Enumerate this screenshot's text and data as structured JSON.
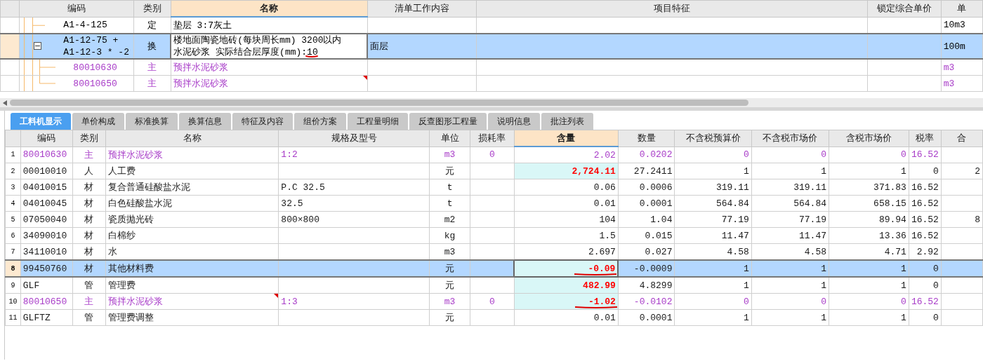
{
  "top_table": {
    "columns": [
      {
        "label": "编码",
        "selected": false
      },
      {
        "label": "类别",
        "selected": false
      },
      {
        "label": "名称",
        "selected": true
      },
      {
        "label": "清单工作内容",
        "selected": false
      },
      {
        "label": "项目特征",
        "selected": false
      },
      {
        "label": "锁定综合单价",
        "selected": false
      },
      {
        "label": "单",
        "selected": false
      }
    ],
    "rows": [
      {
        "code": "A1-4-125",
        "type": "定",
        "kind": "quota",
        "name": "垫层 3:7灰土",
        "unit": "10m3",
        "selected": false,
        "marked": false,
        "note": false
      },
      {
        "code": "A1-12-75 + A1-12-3 * -2",
        "type": "换",
        "kind": "quota",
        "name": "楼地面陶瓷地砖(每块周长mm) 3200以内水泥砂浆  实际结合层厚度(mm):10",
        "work": "面层",
        "unit": "100m",
        "selected": true,
        "marked": true,
        "note": false,
        "expanded": true,
        "children": [
          {
            "code": "80010630",
            "type": "主",
            "kind": "main",
            "name": "预拌水泥砂浆",
            "unit": "m3",
            "selected": false,
            "marked": false,
            "note": false
          },
          {
            "code": "80010650",
            "type": "主",
            "kind": "main",
            "name": "预拌水泥砂浆",
            "unit": "m3",
            "selected": false,
            "marked": false,
            "note": true
          }
        ]
      }
    ]
  },
  "tabs": [
    {
      "label": "工料机显示",
      "selected": true
    },
    {
      "label": "单价构成",
      "selected": false
    },
    {
      "label": "标准换算",
      "selected": false
    },
    {
      "label": "换算信息",
      "selected": false
    },
    {
      "label": "特征及内容",
      "selected": false
    },
    {
      "label": "组价方案",
      "selected": false
    },
    {
      "label": "工程量明细",
      "selected": false
    },
    {
      "label": "反查图形工程量",
      "selected": false
    },
    {
      "label": "说明信息",
      "selected": false
    },
    {
      "label": "批注列表",
      "selected": false
    }
  ],
  "grid": {
    "columns": [
      {
        "label": "编码",
        "selected": false
      },
      {
        "label": "类别",
        "selected": false
      },
      {
        "label": "名称",
        "selected": false
      },
      {
        "label": "规格及型号",
        "selected": false
      },
      {
        "label": "单位",
        "selected": false
      },
      {
        "label": "损耗率",
        "selected": false
      },
      {
        "label": "含量",
        "selected": true
      },
      {
        "label": "数量",
        "selected": false
      },
      {
        "label": "不含税预算价",
        "selected": false
      },
      {
        "label": "不含税市场价",
        "selected": false
      },
      {
        "label": "含税市场价",
        "selected": false
      },
      {
        "label": "税率",
        "selected": false
      },
      {
        "label": "合",
        "selected": false
      }
    ],
    "rows": [
      {
        "no": "1",
        "code": "80010630",
        "type": "主",
        "kind": "main",
        "name": "预拌水泥砂浆",
        "spec": "1:2",
        "unit": "m3",
        "loss": "0",
        "qty": "2.02",
        "qty_highlight": false,
        "qty_marked": false,
        "amount": "0.0202",
        "budget": "0",
        "market": "0",
        "tax_market": "0",
        "rate": "16.52",
        "selected": false,
        "note": false
      },
      {
        "no": "2",
        "code": "00010010",
        "type": "人",
        "kind": "normal",
        "name": "人工费",
        "unit": "元",
        "qty": "2,724.11",
        "qty_highlight": true,
        "qty_marked": false,
        "amount": "27.2411",
        "budget": "1",
        "market": "1",
        "tax_market": "1",
        "rate": "0",
        "total": "2",
        "selected": false,
        "note": false
      },
      {
        "no": "3",
        "code": "04010015",
        "type": "材",
        "kind": "normal",
        "name": "复合普通硅酸盐水泥",
        "spec": "P.C 32.5",
        "unit": "t",
        "qty": "0.06",
        "qty_highlight": false,
        "qty_marked": false,
        "amount": "0.0006",
        "budget": "319.11",
        "market": "319.11",
        "tax_market": "371.83",
        "rate": "16.52",
        "selected": false,
        "note": false
      },
      {
        "no": "4",
        "code": "04010045",
        "type": "材",
        "kind": "normal",
        "name": "白色硅酸盐水泥",
        "spec": "32.5",
        "unit": "t",
        "qty": "0.01",
        "qty_highlight": false,
        "qty_marked": false,
        "amount": "0.0001",
        "budget": "564.84",
        "market": "564.84",
        "tax_market": "658.15",
        "rate": "16.52",
        "selected": false,
        "note": false
      },
      {
        "no": "5",
        "code": "07050040",
        "type": "材",
        "kind": "normal",
        "name": "瓷质抛光砖",
        "spec": "800×800",
        "unit": "m2",
        "qty": "104",
        "qty_highlight": false,
        "qty_marked": false,
        "amount": "1.04",
        "budget": "77.19",
        "market": "77.19",
        "tax_market": "89.94",
        "rate": "16.52",
        "total": "8",
        "selected": false,
        "note": false
      },
      {
        "no": "6",
        "code": "34090010",
        "type": "材",
        "kind": "normal",
        "name": "白棉纱",
        "unit": "kg",
        "qty": "1.5",
        "qty_highlight": false,
        "qty_marked": false,
        "amount": "0.015",
        "budget": "11.47",
        "market": "11.47",
        "tax_market": "13.36",
        "rate": "16.52",
        "selected": false,
        "note": false
      },
      {
        "no": "7",
        "code": "34110010",
        "type": "材",
        "kind": "normal",
        "name": "水",
        "unit": "m3",
        "qty": "2.697",
        "qty_highlight": false,
        "qty_marked": false,
        "amount": "0.027",
        "budget": "4.58",
        "market": "4.58",
        "tax_market": "4.71",
        "rate": "2.92",
        "selected": false,
        "note": false
      },
      {
        "no": "8",
        "code": "99450760",
        "type": "材",
        "kind": "normal",
        "name": "其他材料费",
        "unit": "元",
        "qty": "-0.09",
        "qty_highlight": true,
        "qty_marked": true,
        "amount": "-0.0009",
        "budget": "1",
        "market": "1",
        "tax_market": "1",
        "rate": "0",
        "selected": true,
        "note": false
      },
      {
        "no": "9",
        "code": "GLF",
        "type": "管",
        "kind": "normal",
        "name": "管理费",
        "unit": "元",
        "qty": "482.99",
        "qty_highlight": true,
        "qty_marked": false,
        "amount": "4.8299",
        "budget": "1",
        "market": "1",
        "tax_market": "1",
        "rate": "0",
        "selected": false,
        "note": false
      },
      {
        "no": "10",
        "code": "80010650",
        "type": "主",
        "kind": "main",
        "name": "预拌水泥砂浆",
        "spec": "1:3",
        "unit": "m3",
        "loss": "0",
        "qty": "-1.02",
        "qty_highlight": true,
        "qty_marked": true,
        "amount": "-0.0102",
        "budget": "0",
        "market": "0",
        "tax_market": "0",
        "rate": "16.52",
        "selected": false,
        "note": true
      },
      {
        "no": "11",
        "code": "GLFTZ",
        "type": "管",
        "kind": "normal",
        "name": "管理费调整",
        "unit": "元",
        "qty": "0.01",
        "qty_highlight": false,
        "qty_marked": false,
        "amount": "0.0001",
        "budget": "1",
        "market": "1",
        "tax_market": "1",
        "rate": "0",
        "selected": false,
        "note": false
      }
    ]
  }
}
